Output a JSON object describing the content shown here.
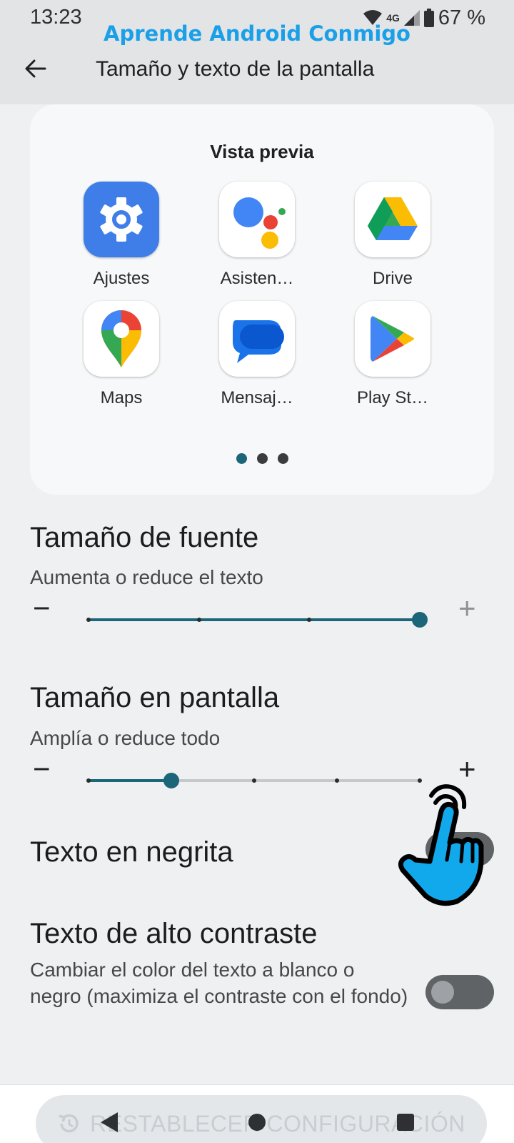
{
  "status_bar": {
    "time": "13:23",
    "network": "4G",
    "battery": "67 %",
    "icons": [
      "wifi-icon",
      "signal-icon",
      "battery-icon"
    ]
  },
  "watermark": "Aprende Android Conmigo",
  "app_bar": {
    "title": "Tamaño y texto de la pantalla",
    "back_icon": "arrow-back-icon"
  },
  "preview": {
    "title": "Vista previa",
    "apps": [
      {
        "label": "Ajustes",
        "icon": "settings-gear-icon"
      },
      {
        "label": "Asisten…",
        "icon": "assistant-icon"
      },
      {
        "label": "Drive",
        "icon": "drive-icon"
      },
      {
        "label": "Maps",
        "icon": "maps-pin-icon"
      },
      {
        "label": "Mensaj…",
        "icon": "messages-icon"
      },
      {
        "label": "Play St…",
        "icon": "play-store-icon"
      }
    ],
    "page_count": 3,
    "active_page": 0
  },
  "font_size": {
    "title": "Tamaño de fuente",
    "subtitle": "Aumenta o reduce el texto",
    "decrease": "−",
    "increase": "+",
    "steps": 4,
    "value_index": 3
  },
  "display_size": {
    "title": "Tamaño en pantalla",
    "subtitle": "Amplía o reduce todo",
    "decrease": "−",
    "increase": "+",
    "steps": 5,
    "value_index": 1
  },
  "bold_text": {
    "title": "Texto en negrita",
    "enabled": false
  },
  "high_contrast": {
    "title": "Texto de alto contraste",
    "subtitle": "Cambiar el color del texto a blanco o negro (maximiza el contraste con el fondo)",
    "enabled": false
  },
  "reset_button": {
    "label": "RESTABLECER CONFIGURACIÓN",
    "icon": "history-icon"
  },
  "nav_bar": [
    "nav-back-icon",
    "nav-home-icon",
    "nav-recents-icon"
  ],
  "colors": {
    "accent": "#1b6678",
    "background": "#eef0f2",
    "watermark": "#1aa0e8",
    "pointer_hand": "#12a9ec"
  }
}
